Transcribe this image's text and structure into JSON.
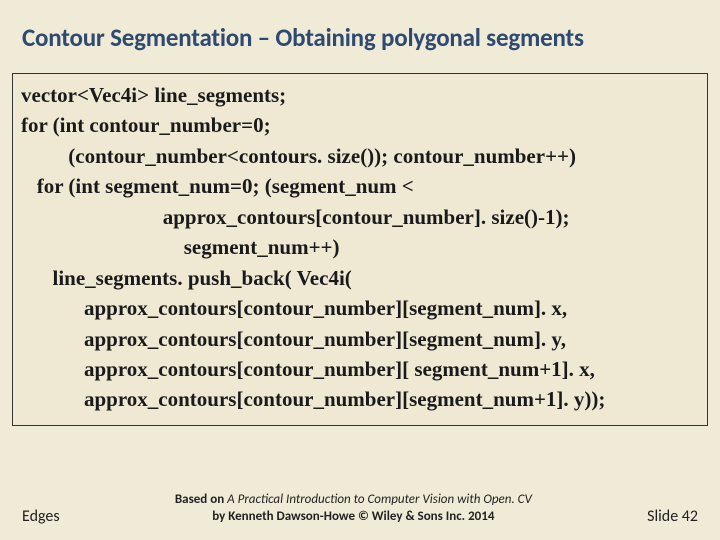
{
  "title": "Contour Segmentation – Obtaining polygonal segments",
  "code": {
    "lines": [
      "vector<Vec4i> line_segments;",
      "for (int contour_number=0;",
      "         (contour_number<contours. size()); contour_number++)",
      "   for (int segment_num=0; (segment_num <",
      "                           approx_contours[contour_number]. size()-1);",
      "                               segment_num++)",
      "      line_segments. push_back( Vec4i(",
      "            approx_contours[contour_number][segment_num]. x,",
      "            approx_contours[contour_number][segment_num]. y,",
      "            approx_contours[contour_number][ segment_num+1]. x,",
      "            approx_contours[contour_number][segment_num+1]. y));"
    ]
  },
  "footer": {
    "left": "Edges",
    "center_prefix": "Based on ",
    "center_title": "A Practical Introduction to Computer Vision with Open. CV",
    "center_suffix": " by Kenneth Dawson-Howe © Wiley & Sons Inc. 2014",
    "right": "Slide 42"
  }
}
